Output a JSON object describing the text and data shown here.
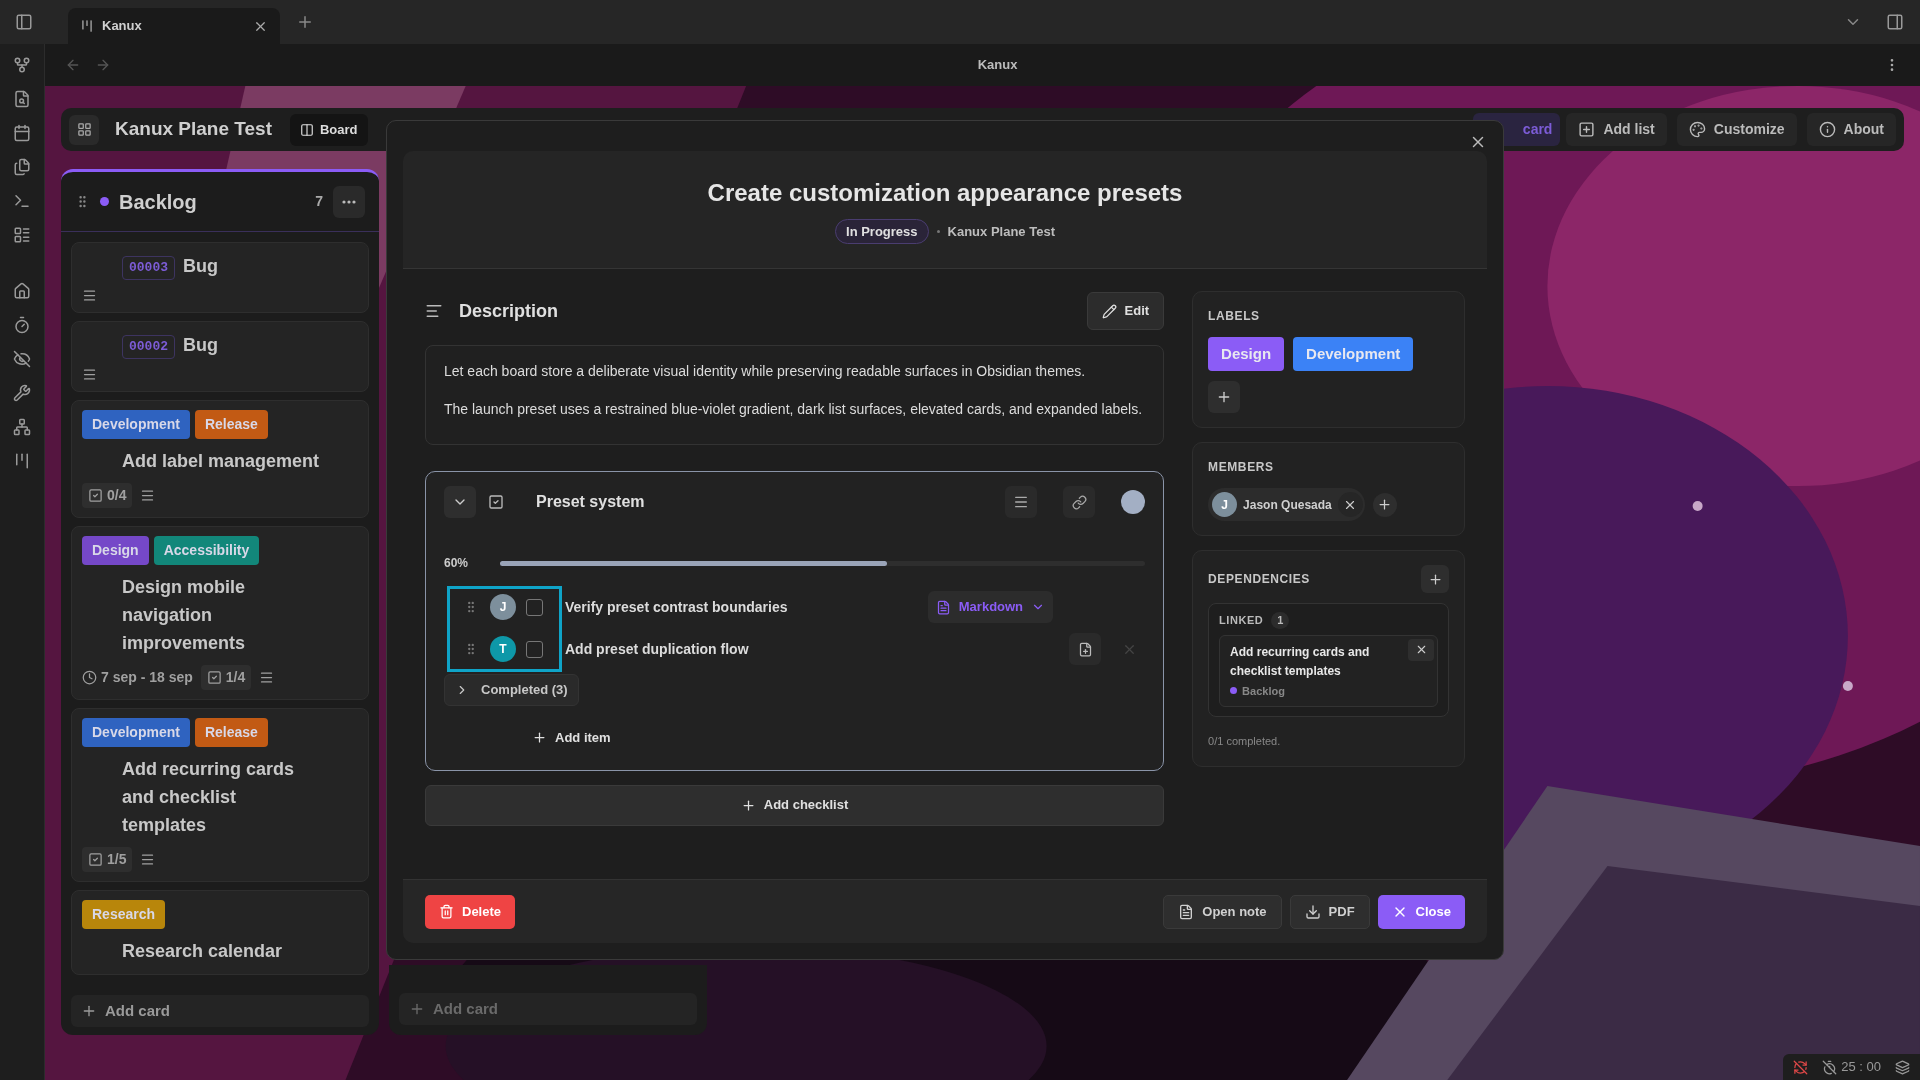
{
  "app_tab": {
    "title": "Kanux",
    "selected": true
  },
  "nav": {
    "title": "Kanux"
  },
  "board": {
    "title": "Kanux Plane Test",
    "views": [
      {
        "label": "Board",
        "selected": true
      }
    ],
    "actions": [
      {
        "label": "card",
        "kind": "primary"
      },
      {
        "label": "Add list",
        "kind": "add"
      },
      {
        "label": "Customize",
        "kind": "palette"
      },
      {
        "label": "About",
        "kind": "info"
      }
    ]
  },
  "list": {
    "title": "Backlog",
    "color": "#8b5cf6",
    "count": "7",
    "add_card": "Add card",
    "cards": [
      {
        "id": "00003",
        "title": "Bug",
        "has_description": true
      },
      {
        "id": "00002",
        "title": "Bug",
        "has_description": true
      },
      {
        "title": "Add label management",
        "labels": [
          {
            "name": "Development",
            "color": "#2f63c0"
          },
          {
            "name": "Release",
            "color": "#c25a14"
          }
        ],
        "checklist": "0/4",
        "has_description": true
      },
      {
        "title": "Design mobile navigation improvements",
        "labels": [
          {
            "name": "Design",
            "color": "#7548c8"
          },
          {
            "name": "Accessibility",
            "color": "#12877a"
          }
        ],
        "dates": "7 sep - 18 sep",
        "checklist": "1/4",
        "has_description": true
      },
      {
        "title": "Add recurring cards and checklist templates",
        "labels": [
          {
            "name": "Development",
            "color": "#2f63c0"
          },
          {
            "name": "Release",
            "color": "#c25a14"
          }
        ],
        "checklist": "1/5",
        "has_description": true
      },
      {
        "title": "Research calendar",
        "labels": [
          {
            "name": "Research",
            "color": "#b8860b"
          }
        ]
      }
    ]
  },
  "second_list": {
    "add_card": "Add card"
  },
  "modal": {
    "title": "Create customization appearance presets",
    "status": "In Progress",
    "board": "Kanux Plane Test",
    "description": {
      "heading": "Description",
      "edit": "Edit",
      "paragraphs": [
        "Let each board store a deliberate visual identity while preserving readable surfaces in Obsidian themes.",
        "The launch preset uses a restrained blue-violet gradient, dark list surfaces, elevated cards, and expanded labels."
      ]
    },
    "checklist": {
      "title": "Preset system",
      "progress": "60%",
      "level": 0.6,
      "items": [
        {
          "text": "Verify preset contrast boundaries",
          "avatar": "J",
          "color": "#7d8f9c",
          "checked": false,
          "format": "Markdown"
        },
        {
          "text": "Add preset duplication flow",
          "avatar": "T",
          "color": "#0e98a8",
          "checked": false
        }
      ],
      "completed": "Completed (3)",
      "add_item": "Add item"
    },
    "add_checklist": "Add checklist",
    "labels": {
      "heading": "LABELS",
      "items": [
        {
          "name": "Design",
          "color": "#8b5cf6"
        },
        {
          "name": "Development",
          "color": "#3b82f6"
        }
      ]
    },
    "members": {
      "heading": "MEMBERS",
      "items": [
        {
          "initial": "J",
          "name": "Jason Quesada"
        }
      ]
    },
    "dependencies": {
      "heading": "DEPENDENCIES",
      "linked": "LINKED",
      "linked_count": "1",
      "items": [
        {
          "title": "Add recurring cards and checklist templates",
          "list": "Backlog",
          "color": "#8b5cf6"
        }
      ],
      "summary": "0/1 completed."
    },
    "delete": "Delete",
    "actions": [
      {
        "label": "Open note",
        "kind": "note"
      },
      {
        "label": "PDF",
        "kind": "download"
      },
      {
        "label": "Close",
        "kind": "close"
      }
    ]
  },
  "status_bar": {
    "timer": "25 : 00"
  }
}
